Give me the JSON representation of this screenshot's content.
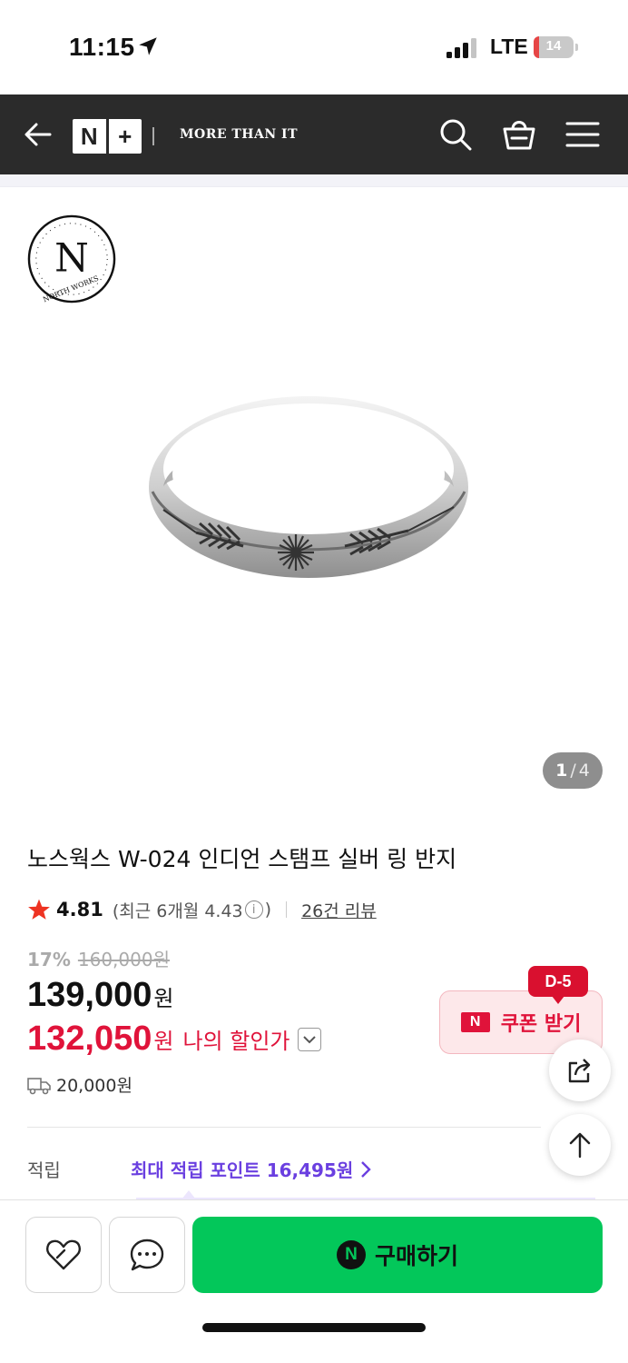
{
  "status_bar": {
    "time": "11:15",
    "network": "LTE",
    "battery_level": "14",
    "battery_fraction": 0.14
  },
  "nav": {
    "logo_left": "N",
    "logo_right": "+",
    "tagline": "MORE THAN IT",
    "icons": [
      "back-arrow-icon",
      "search-icon",
      "shopping-basket-icon",
      "hamburger-menu-icon"
    ]
  },
  "gallery": {
    "brand_logo_letter": "N",
    "brand_logo_text": "NORTH WORKS",
    "current": "1",
    "separator": "/",
    "total": "4"
  },
  "product": {
    "title": "노스웍스 W-024 인디언 스탬프 실버 링 반지",
    "rating": "4.81",
    "recent_rating_label": "(최근 6개월 4.43",
    "recent_rating_close": ")",
    "review_count_label": "26건 리뷰",
    "discount_rate": "17%",
    "original_price": "160,000원",
    "price": "139,000",
    "price_unit": "원",
    "my_price": "132,050",
    "my_price_unit": "원",
    "my_price_label": "나의 할인가",
    "shipping_fee": "20,000원"
  },
  "coupon": {
    "badge": "D-5",
    "logo": "N",
    "label": "쿠폰 받기"
  },
  "points": {
    "label": "적립",
    "value": "최대 적립 포인트 16,495원"
  },
  "bottom_bar": {
    "buy_logo": "N",
    "buy_label": "구매하기"
  },
  "colors": {
    "nav_bg": "#2b2b2b",
    "sale_red": "#e0133a",
    "points_purple": "#6a3fe0",
    "buy_green": "#03c75a",
    "star": "#ee3322"
  }
}
